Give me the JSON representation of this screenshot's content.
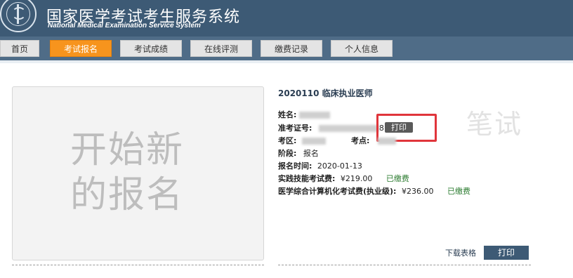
{
  "header": {
    "title_cn": "国家医学考试考生服务系统",
    "title_en": "National Medical Examination Service System"
  },
  "nav": {
    "items": [
      {
        "label": "首页",
        "active": false
      },
      {
        "label": "考试报名",
        "active": true
      },
      {
        "label": "考试成绩",
        "active": false
      },
      {
        "label": "在线评测",
        "active": false
      },
      {
        "label": "缴费记录",
        "active": false
      },
      {
        "label": "个人信息",
        "active": false
      }
    ]
  },
  "card": {
    "text_line1": "开始新",
    "text_line2": "的报名"
  },
  "exam": {
    "title": "2020110 临床执业医师",
    "name_label": "姓名:",
    "ticket_label": "准考证号:",
    "ticket_suffix": "8",
    "print_small_label": "打印",
    "region_label": "考区:",
    "site_label": "考点:",
    "stage_label": "阶段:",
    "stage_value": "报名",
    "reg_time_label": "报名时间:",
    "reg_time_value": "2020-01-13",
    "fee1_label": "实践技能考试费:",
    "fee1_value": "¥219.00",
    "fee1_status": "已缴费",
    "fee2_label": "医学综合计算机化考试费(执业级):",
    "fee2_value": "¥236.00",
    "fee2_status": "已缴费",
    "stamp": "笔试",
    "download_label": "下载表格",
    "print_label": "打印"
  },
  "colors": {
    "header_bg": "#3d5a75",
    "nav_active": "#f7941d",
    "paid_green": "#2e7d32",
    "highlight_red": "#e0353b"
  }
}
